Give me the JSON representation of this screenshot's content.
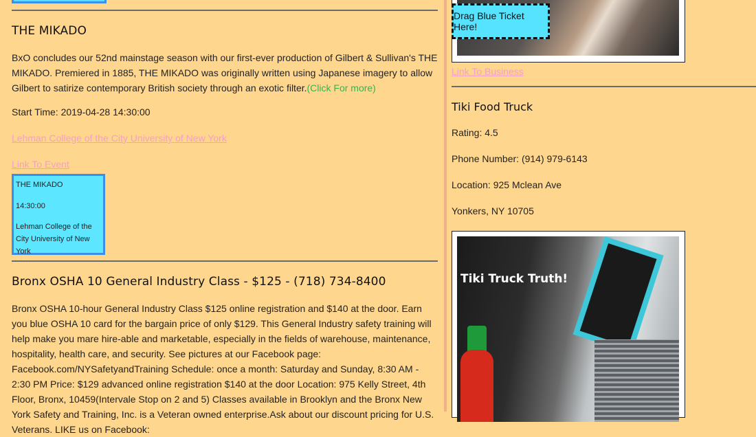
{
  "events": [
    {
      "title": "THE MIKADO",
      "description": "BxO concludes our 52nd mainstage season with our first-ever production of Gilbert & Sullivan's THE MIKADO. Premiered in 1885, THE MIKADO was originally written using Japanese imagery to allow Gilbert to satirize contemporary British society through an exotic filter.",
      "more_label": "(Click For more)",
      "start_time": "Start Time: 2019-04-28 14:30:00",
      "venue_link": "Lehman College of the City University of New York",
      "event_link": "Link To Event",
      "ticket": {
        "title": "THE MIKADO",
        "time": "14:30:00",
        "venue": "Lehman College of the City University of New York"
      }
    },
    {
      "title": "Bronx OSHA 10 General Industry Class - $125 - (718) 734-8400",
      "description": "Bronx OSHA 10-hour General Industry Class $125 online registration and $140 at the door. Earn you blue OSHA 10 card for the bargain price of only $129. This General Industry safety training will help make you mare hire-able and marketable, especially in the fields of warehouse, maintenance, hospitality, health care, and security. See pictures at our Facebook page: Facebook.com/NYSafetyandTraining Schedule: once a month: Saturday and Sunday, 8:30 AM - 2:30 PM Price: $129 advanced online registration $140 at the door Location: 975 Kelly Street, 4th Floor, Bronx, 10459(Intervale Stop on 2 and 5) Classes available in Brooklyn and the Bronx New York Safety and Training, Inc. is a Veteran owned enterprise.Ask about our discount pricing for U.S. Veterans. LIKE us on Facebook:"
    }
  ],
  "drag_target_label": "Drag Blue Ticket Here!",
  "business_link": "Link To Business",
  "business": {
    "name": "Tiki Food Truck",
    "rating": "Rating: 4.5",
    "phone": "Phone Number: (914) 979-6143",
    "location": "Location: 925 Mclean Ave",
    "city": "Yonkers, NY 10705",
    "image_caption": "Tiki Truck Truth!"
  },
  "colors": {
    "background": "#FFD68E",
    "ticket": "#5CE6FF",
    "link": "#F3A0C6",
    "more": "#38B24A"
  }
}
